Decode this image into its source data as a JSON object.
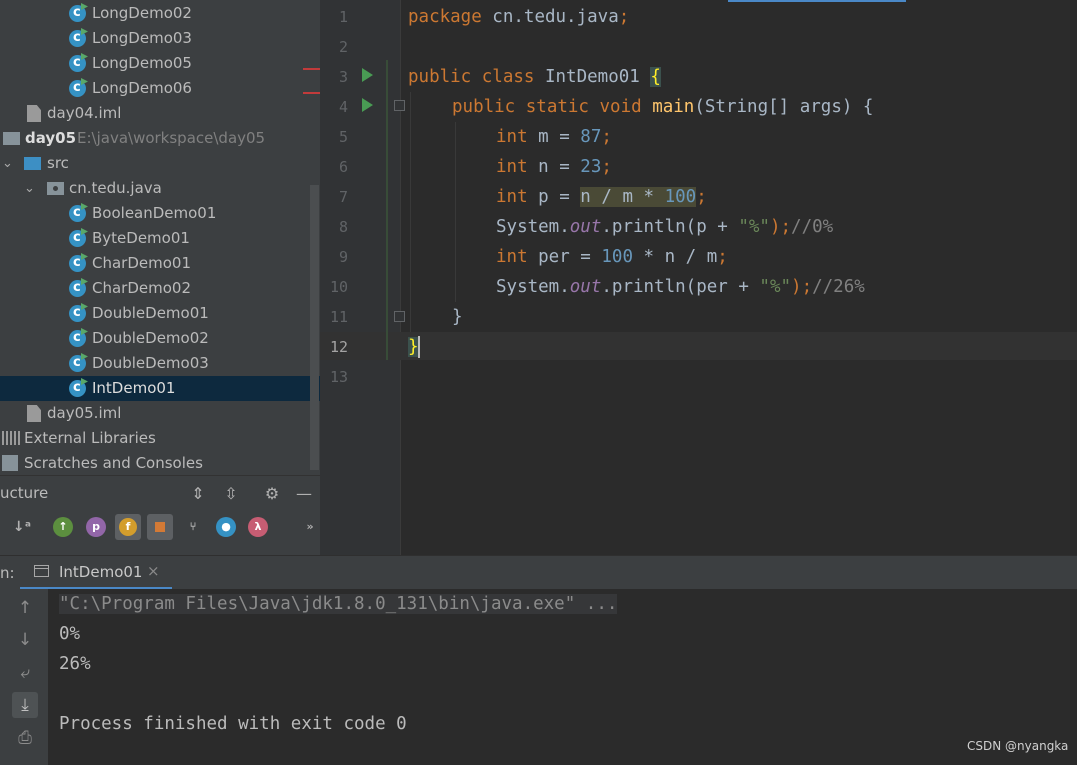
{
  "project_tree": {
    "items": [
      {
        "label": "LongDemo02",
        "type": "class"
      },
      {
        "label": "LongDemo03",
        "type": "class"
      },
      {
        "label": "LongDemo05",
        "type": "class"
      },
      {
        "label": "LongDemo06",
        "type": "class"
      },
      {
        "label": "day04.iml",
        "type": "file"
      },
      {
        "label": "day05",
        "path": "E:\\java\\workspace\\day05",
        "type": "module"
      },
      {
        "label": "src",
        "type": "folder"
      },
      {
        "label": "cn.tedu.java",
        "type": "package"
      },
      {
        "label": "BooleanDemo01",
        "type": "class"
      },
      {
        "label": "ByteDemo01",
        "type": "class"
      },
      {
        "label": "CharDemo01",
        "type": "class"
      },
      {
        "label": "CharDemo02",
        "type": "class"
      },
      {
        "label": "DoubleDemo01",
        "type": "class"
      },
      {
        "label": "DoubleDemo02",
        "type": "class"
      },
      {
        "label": "DoubleDemo03",
        "type": "class"
      },
      {
        "label": "IntDemo01",
        "type": "class",
        "selected": true
      },
      {
        "label": "day05.iml",
        "type": "file"
      },
      {
        "label": "External Libraries",
        "type": "library"
      },
      {
        "label": "Scratches and Consoles",
        "type": "scratch"
      }
    ]
  },
  "structure": {
    "title": "ucture",
    "icons": [
      "sort-alpha-icon",
      "inherited-icon",
      "properties-icon",
      "fields-icon",
      "non-public-icon",
      "anonymous-classes-icon",
      "run-icon",
      "lambdas-icon",
      "more-icon"
    ],
    "icon_letters": {
      "p": "p",
      "f": "f",
      "lambda": "λ",
      "more": "»"
    }
  },
  "editor": {
    "line_numbers": [
      "1",
      "2",
      "3",
      "4",
      "5",
      "6",
      "7",
      "8",
      "9",
      "10",
      "11",
      "12",
      "13"
    ],
    "active_line": "12",
    "lines": {
      "l1_kw": "package",
      "l1_rest": " cn.tedu.java",
      "l1_semi": ";",
      "l3_kw": "public class",
      "l3_name": " IntDemo01 ",
      "l3_brace": "{",
      "l4_kw": "public static void",
      "l4_sp": " ",
      "l4_fn": "main",
      "l4_rest": "(String[] args) {",
      "l5_kw": "int",
      "l5_rest": " m = ",
      "l5_num": "87",
      "l5_semi": ";",
      "l6_kw": "int",
      "l6_rest": " n = ",
      "l6_num": "23",
      "l6_semi": ";",
      "l7_kw": "int",
      "l7_rest": " p = ",
      "l7_sel1": "n / m * ",
      "l7_num": "100",
      "l7_semi": ";",
      "l8_a": "System.",
      "l8_fld": "out",
      "l8_b": ".println(p + ",
      "l8_str": "\"%\"",
      "l8_c": ");",
      "l8_cmt": "//0%",
      "l9_kw": "int",
      "l9_rest": " per = ",
      "l9_num": "100",
      "l9_rest2": " * n / m",
      "l9_semi": ";",
      "l10_a": "System.",
      "l10_fld": "out",
      "l10_b": ".println(per + ",
      "l10_str": "\"%\"",
      "l10_c": ");",
      "l10_cmt": "//26%",
      "l11": "}",
      "l12": "}"
    }
  },
  "run_panel": {
    "label": "n:",
    "tab_label": "IntDemo01",
    "tab_close": "×",
    "console_lines": [
      "\"C:\\Program Files\\Java\\jdk1.8.0_131\\bin\\java.exe\" ...",
      "0%",
      "26%",
      "",
      "Process finished with exit code 0"
    ]
  },
  "watermark": "CSDN @nyangka"
}
